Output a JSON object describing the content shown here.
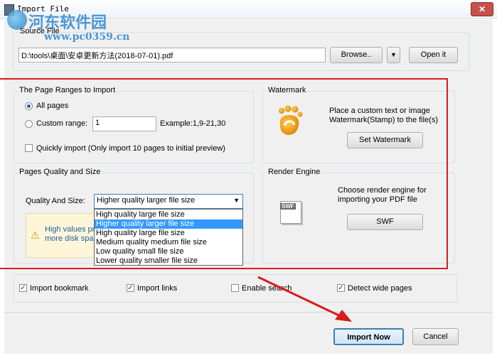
{
  "window": {
    "title": "Import File",
    "close_symbol": "✕"
  },
  "watermark_logo": {
    "name": "河东软件园",
    "url": "www.pc0359.cn"
  },
  "source": {
    "label": "Source File",
    "path": "D:\\tools\\桌面\\安卓更新方法(2018-07-01).pdf",
    "browse_label": "Browse..",
    "open_label": "Open it"
  },
  "page_ranges": {
    "title": "The Page Ranges to Import",
    "all_pages": "All pages",
    "custom_range": "Custom range:",
    "custom_value": "1",
    "example": "Example:1,9-21,30",
    "quick_import": "Quickly import (Only import 10 pages to  initial  preview)"
  },
  "watermark": {
    "title": "Watermark",
    "description": "Place a custom text or image Watermark(Stamp) to the file(s)",
    "button": "Set Watermark"
  },
  "quality": {
    "title": "Pages Quality and Size",
    "label": "Quality And Size:",
    "selected": "Higher quality larger file size",
    "options": [
      "High quality large file size",
      "Higher quality larger file size",
      "High quality large file size",
      "Medium quality medium file size",
      "Low quality small file size",
      "Lower quality smaller file size"
    ],
    "warning_line1": "High values pr",
    "warning_line2": "more disk spac"
  },
  "render": {
    "title": "Render Engine",
    "description": "Choose render engine for importing your PDF file",
    "icon_label": "SWF",
    "button": "SWF"
  },
  "options": {
    "import_bookmark": "Import bookmark",
    "import_links": "Import links",
    "enable_search": "Enable search",
    "detect_wide": "Detect wide pages"
  },
  "footer": {
    "import_now": "Import Now",
    "cancel": "Cancel"
  },
  "colors": {
    "highlight": "#3399ff",
    "annotation_red": "#d81c1c",
    "primary_border": "#3c7fb1"
  }
}
